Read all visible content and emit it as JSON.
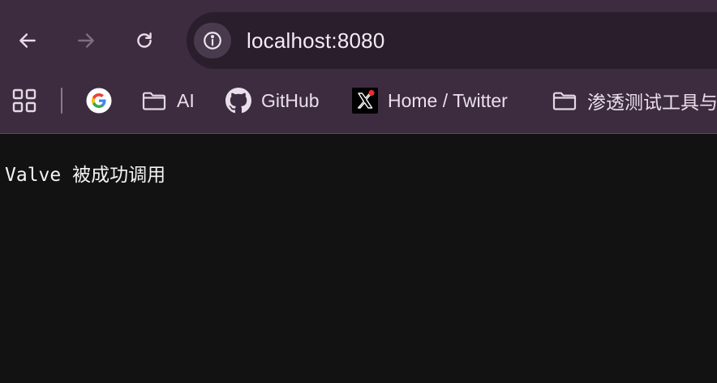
{
  "toolbar": {
    "back_icon": "arrow-left-icon",
    "forward_icon": "arrow-right-icon",
    "reload_icon": "reload-icon",
    "site_info_icon": "info-icon",
    "url": "localhost:8080"
  },
  "bookmarks": {
    "apps_icon": "apps-grid-icon",
    "items": [
      {
        "icon": "google-icon",
        "label": ""
      },
      {
        "icon": "folder-icon",
        "label": "AI"
      },
      {
        "icon": "github-icon",
        "label": "GitHub"
      },
      {
        "icon": "x-twitter-icon",
        "label": "Home / Twitter"
      },
      {
        "icon": "folder-icon",
        "label": "渗透测试工具与"
      }
    ]
  },
  "page": {
    "text": "Valve 被成功调用"
  },
  "colors": {
    "chrome_bg": "#3d2b3f",
    "omnibox_bg": "#2a1d2c",
    "page_bg": "#121212",
    "text": "#f4f4f4"
  }
}
